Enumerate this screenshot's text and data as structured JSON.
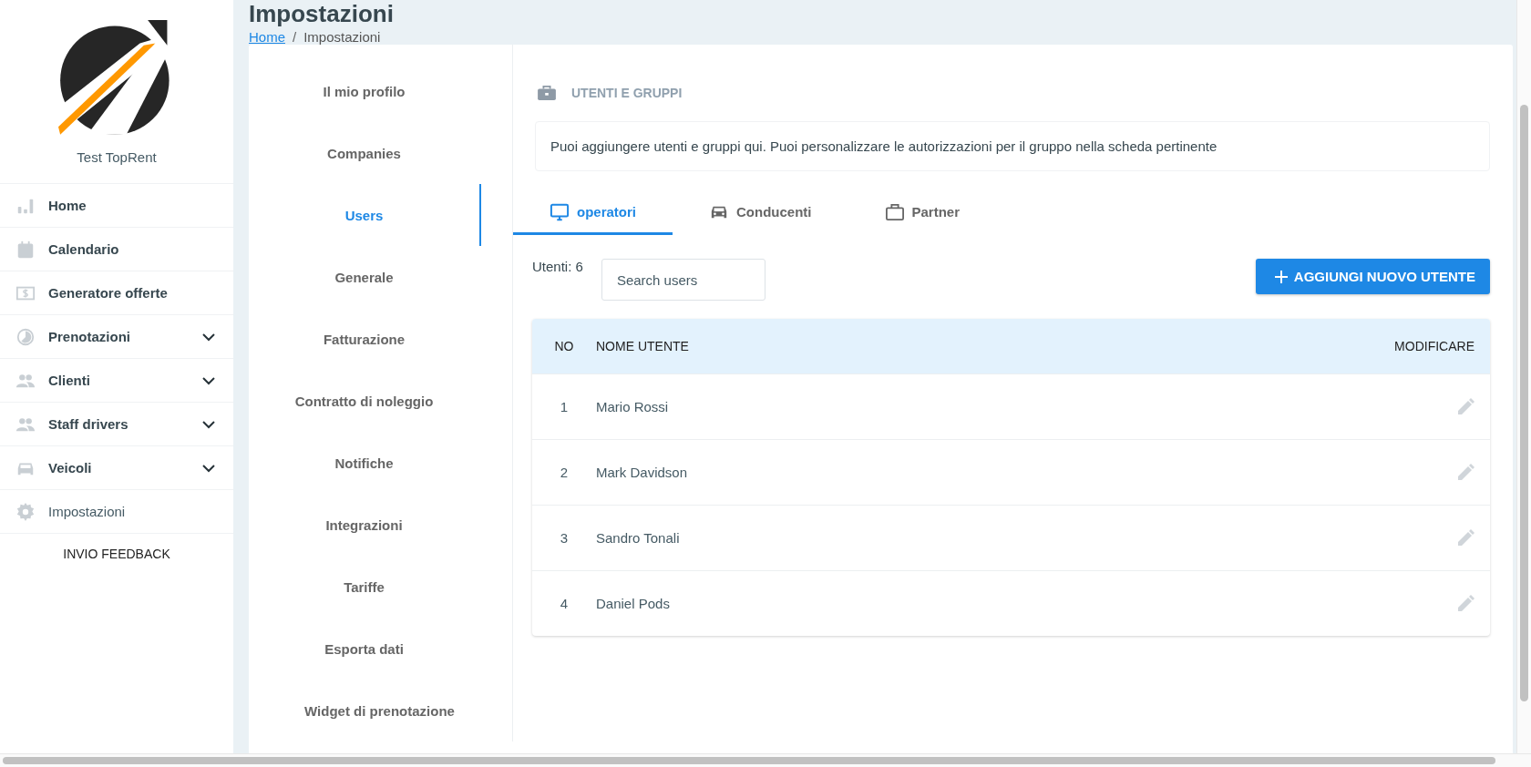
{
  "sidebar": {
    "brand": "Test TopRent",
    "items": [
      {
        "label": "Home",
        "kind": "chart",
        "expandable": false,
        "selected": false
      },
      {
        "label": "Calendario",
        "kind": "calendar",
        "expandable": false,
        "selected": false
      },
      {
        "label": "Generatore offerte",
        "kind": "money",
        "expandable": false,
        "selected": false
      },
      {
        "label": "Prenotazioni",
        "kind": "clock",
        "expandable": true,
        "selected": false
      },
      {
        "label": "Clienti",
        "kind": "people",
        "expandable": true,
        "selected": false
      },
      {
        "label": "Staff drivers",
        "kind": "people",
        "expandable": true,
        "selected": false
      },
      {
        "label": "Veicoli",
        "kind": "car",
        "expandable": true,
        "selected": false
      },
      {
        "label": "Impostazioni",
        "kind": "gear",
        "expandable": false,
        "selected": true
      }
    ],
    "feedback": "INVIO FEEDBACK"
  },
  "page": {
    "title": "Impostazioni",
    "separator": "/",
    "breadcrumb": [
      {
        "label": "Home",
        "link": true
      },
      {
        "label": "Impostazioni",
        "link": false
      }
    ]
  },
  "settings_nav": [
    {
      "label": "Il mio profilo",
      "selected": false
    },
    {
      "label": "Companies",
      "selected": false
    },
    {
      "label": "Users",
      "selected": true
    },
    {
      "label": "Generale",
      "selected": false
    },
    {
      "label": "Fatturazione",
      "selected": false
    },
    {
      "label": "Contratto di noleggio",
      "selected": false
    },
    {
      "label": "Notifiche",
      "selected": false
    },
    {
      "label": "Integrazioni",
      "selected": false
    },
    {
      "label": "Tariffe",
      "selected": false
    },
    {
      "label": "Esporta dati",
      "selected": false
    },
    {
      "label": "Widget di prenotazione",
      "selected": false
    }
  ],
  "section": {
    "title": "UTENTI E GRUPPI",
    "info": "Puoi aggiungere utenti e gruppi qui. Puoi personalizzare le autorizzazioni per il gruppo nella scheda pertinente"
  },
  "tabs": [
    {
      "label": "operatori",
      "kind": "monitor",
      "selected": true
    },
    {
      "label": "Conducenti",
      "kind": "car",
      "selected": false
    },
    {
      "label": "Partner",
      "kind": "briefcase",
      "selected": false
    }
  ],
  "count": "Utenti: 6",
  "search": {
    "placeholder": "Search users"
  },
  "add_button": "AGGIUNGI NUOVO UTENTE",
  "table": {
    "columns": [
      "NO",
      "NOME UTENTE",
      "MODIFICARE"
    ],
    "rows": [
      [
        "1",
        "Mario Rossi"
      ],
      [
        "2",
        "Mark Davidson"
      ],
      [
        "3",
        "Sandro Tonali"
      ],
      [
        "4",
        "Daniel Pods"
      ]
    ]
  }
}
